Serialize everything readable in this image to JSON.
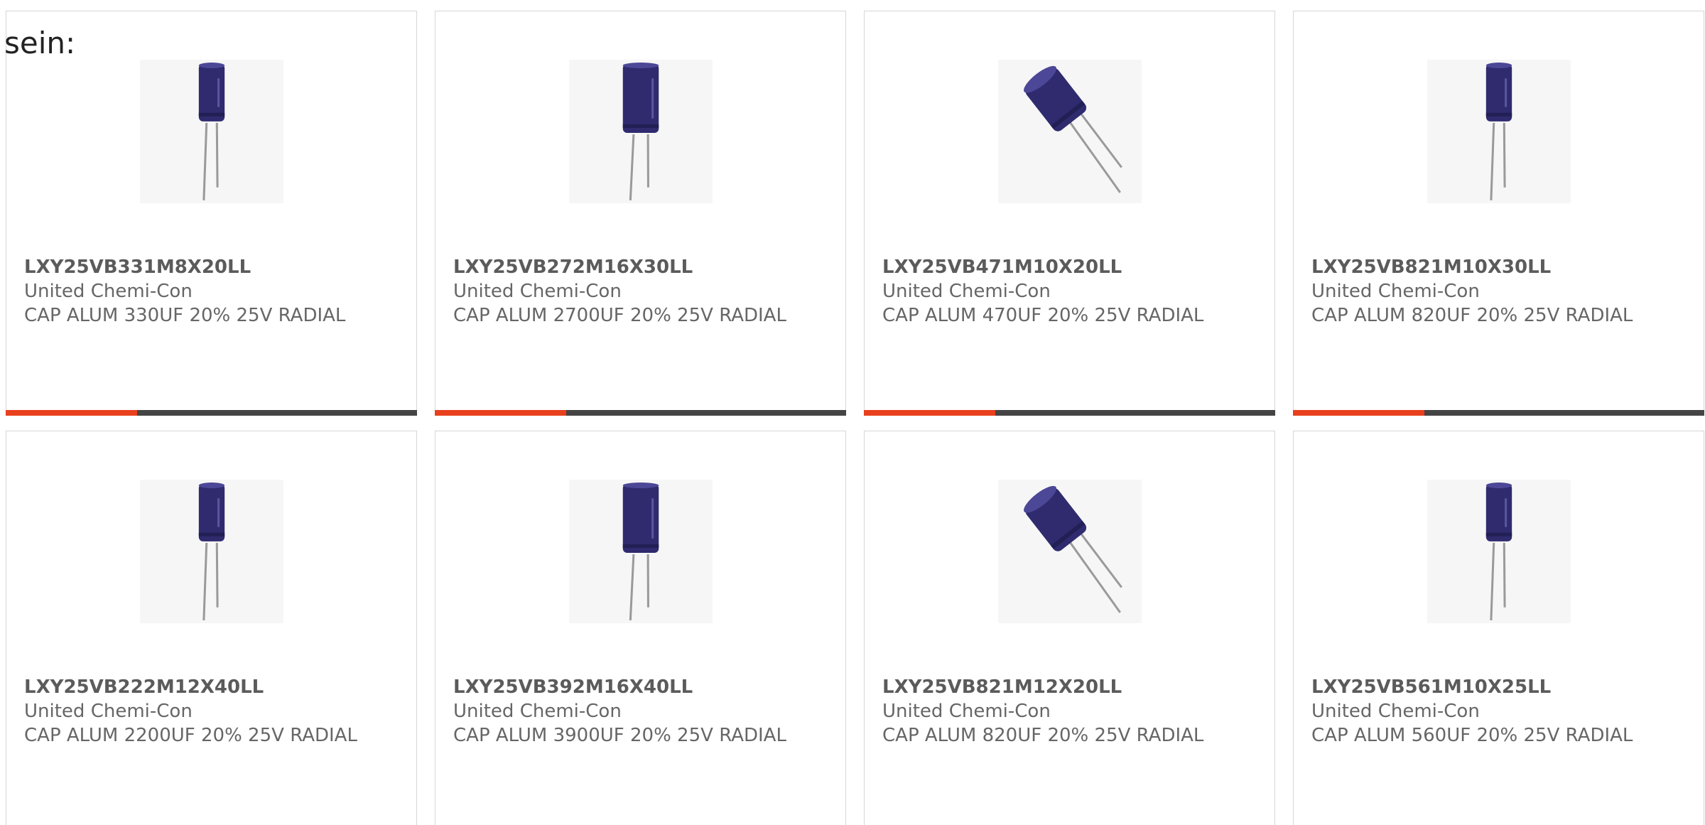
{
  "intro": "sein:",
  "colors": {
    "accent": "#e8401d",
    "track": "#444444",
    "capacitor_body": "#2f2b6e"
  },
  "products": [
    {
      "part_number": "LXY25VB331M8X20LL",
      "manufacturer": "United Chemi-Con",
      "description": "CAP ALUM 330UF 20% 25V RADIAL",
      "image_icon": "capacitor-upright-slim",
      "progress": 0.32
    },
    {
      "part_number": "LXY25VB272M16X30LL",
      "manufacturer": "United Chemi-Con",
      "description": "CAP ALUM 2700UF 20% 25V RADIAL",
      "image_icon": "capacitor-upright-wide",
      "progress": 0.32
    },
    {
      "part_number": "LXY25VB471M10X20LL",
      "manufacturer": "United Chemi-Con",
      "description": "CAP ALUM 470UF 20% 25V RADIAL",
      "image_icon": "capacitor-tilted",
      "progress": 0.32
    },
    {
      "part_number": "LXY25VB821M10X30LL",
      "manufacturer": "United Chemi-Con",
      "description": "CAP ALUM 820UF 20% 25V RADIAL",
      "image_icon": "capacitor-upright-slim",
      "progress": 0.32
    },
    {
      "part_number": "LXY25VB222M12X40LL",
      "manufacturer": "United Chemi-Con",
      "description": "CAP ALUM 2200UF 20% 25V RADIAL",
      "image_icon": "capacitor-upright-slim",
      "progress": null
    },
    {
      "part_number": "LXY25VB392M16X40LL",
      "manufacturer": "United Chemi-Con",
      "description": "CAP ALUM 3900UF 20% 25V RADIAL",
      "image_icon": "capacitor-upright-wide",
      "progress": null
    },
    {
      "part_number": "LXY25VB821M12X20LL",
      "manufacturer": "United Chemi-Con",
      "description": "CAP ALUM 820UF 20% 25V RADIAL",
      "image_icon": "capacitor-tilted",
      "progress": null
    },
    {
      "part_number": "LXY25VB561M10X25LL",
      "manufacturer": "United Chemi-Con",
      "description": "CAP ALUM 560UF 20% 25V RADIAL",
      "image_icon": "capacitor-upright-slim",
      "progress": null
    }
  ]
}
